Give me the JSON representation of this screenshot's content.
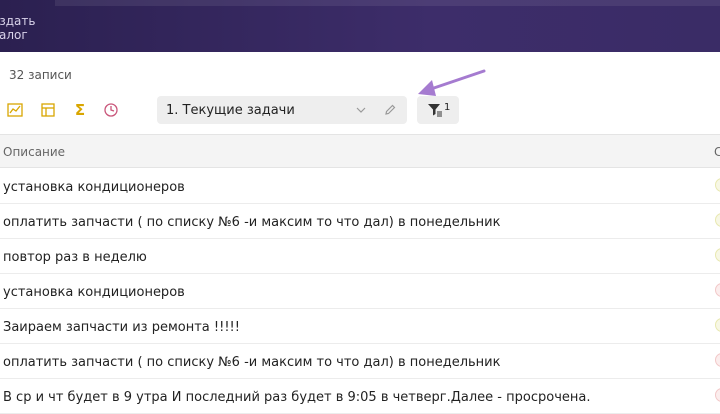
{
  "topbar": {
    "create_label": "оздать\nталог"
  },
  "header": {
    "records": "32 записи"
  },
  "toolbar": {
    "icons": [
      "chart-icon",
      "table-layout-icon",
      "sigma-icon",
      "clock-icon"
    ],
    "filter_select_value": "1. Текущие задачи",
    "filter_count": "1"
  },
  "table": {
    "columns": [
      "Описание",
      "С"
    ],
    "rows": [
      {
        "description": "установка кондиционеров",
        "status_color": "#e8e8b0"
      },
      {
        "description": "оплатить запчасти ( по списку №6 -и максим то что дал) в понедельник",
        "status_color": "#e8e8b0"
      },
      {
        "description": "повтор раз в неделю",
        "status_color": "#e8e8b0"
      },
      {
        "description": "установка кондиционеров",
        "status_color": "#f2c8c8"
      },
      {
        "description": "Заиpаем запчасти из ремонта !!!!!",
        "status_color": "#e8e8b0"
      },
      {
        "description": "оплатить запчасти ( по списку №6 -и максим то что дал) в понедельник",
        "status_color": "#f2c8c8"
      },
      {
        "description": "В ср и чт будет в 9 утра И последний раз будет в 9:05 в четверг.Далее - просрочена.",
        "status_color": "#f2c8c8"
      }
    ]
  },
  "colors": {
    "accent": "#d9a600",
    "clock": "#c9567a",
    "arrow": "#a57bd0",
    "topbar": "#3a2c66"
  }
}
